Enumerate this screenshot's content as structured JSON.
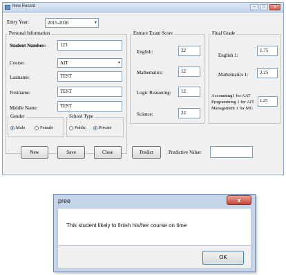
{
  "window": {
    "title": "New Record",
    "controls": {
      "minimize": "–",
      "maximize": "□",
      "close": "x"
    }
  },
  "entry_year": {
    "label": "Entry Year:",
    "value": "2015-2016"
  },
  "personal": {
    "group_title": "Personal Information",
    "student_number": {
      "label": "Student Number:",
      "value": "123"
    },
    "course": {
      "label": "Course:",
      "value": "AIT"
    },
    "lastname": {
      "label": "Lastname:",
      "value": "TEST"
    },
    "firstname": {
      "label": "Firstname:",
      "value": "TEST"
    },
    "middle_name": {
      "label": "Middle Name:",
      "value": "TEST"
    },
    "gender": {
      "title": "Gender",
      "options": [
        "Male",
        "Female"
      ],
      "selected": "Male"
    },
    "school_type": {
      "title": "School Type",
      "options": [
        "Public",
        "Private"
      ],
      "selected": "Private"
    }
  },
  "entrance": {
    "group_title": "Entrace Exam Score",
    "english": {
      "label": "English:",
      "value": "22"
    },
    "mathematics": {
      "label": "Mathematics:",
      "value": "12"
    },
    "logic": {
      "label": "Logic Reasoning:",
      "value": "12"
    },
    "science": {
      "label": "Science:",
      "value": "22"
    }
  },
  "final_grade": {
    "group_title": "Final Grade",
    "english1": {
      "label": "English 1:",
      "value": "1.75"
    },
    "mathematics1": {
      "label": "Mathematics 1:",
      "value": "2.25"
    },
    "accounting": {
      "label_line1": "Accounting1 for AAT",
      "label_line2": "Programming 1 for AIT",
      "label_line3": "Management 1 for MG",
      "value": "1.25"
    }
  },
  "buttons": {
    "new": "New",
    "save": "Save",
    "close": "Close",
    "predict": "Predict",
    "predictive_value_label": "Predictive Value:",
    "predictive_value": ""
  },
  "dialog": {
    "title": "pree",
    "close": "x",
    "message": "This student likely to finish his/her course on time",
    "ok": "OK"
  },
  "colors": {
    "titlebar": "#c4d6ec",
    "dialog_frame": "#c4d5ea",
    "close_red": "#c4443a"
  }
}
